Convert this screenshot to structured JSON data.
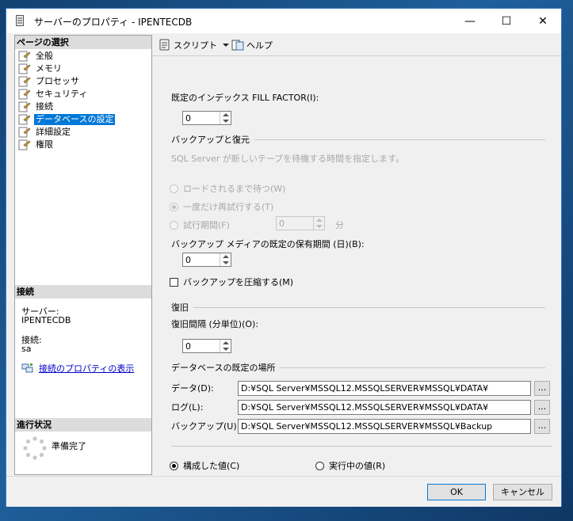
{
  "window": {
    "title": "サーバーのプロパティ - IPENTECDB",
    "minimize": "—",
    "maximize": "☐",
    "close": "✕"
  },
  "left_pane": {
    "header": "ページの選択",
    "items": [
      {
        "label": "全般",
        "selected": false
      },
      {
        "label": "メモリ",
        "selected": false
      },
      {
        "label": "プロセッサ",
        "selected": false
      },
      {
        "label": "セキュリティ",
        "selected": false
      },
      {
        "label": "接続",
        "selected": false
      },
      {
        "label": "データベースの設定",
        "selected": true
      },
      {
        "label": "詳細設定",
        "selected": false
      },
      {
        "label": "権限",
        "selected": false
      }
    ],
    "connection_header": "接続",
    "server_label": "サーバー:",
    "server_value": "IPENTECDB",
    "connection_label": "接続:",
    "connection_value": "sa",
    "connection_link": "接続のプロパティの表示",
    "progress_header": "進行状況",
    "progress_status": "準備完了"
  },
  "toolbar": {
    "script_label": "スクリプト",
    "help_label": "ヘルプ"
  },
  "content": {
    "fill_factor_label": "既定のインデックス FILL FACTOR(I):",
    "fill_factor_value": "0",
    "backup_restore_title": "バックアップと復元",
    "tape_wait_label": "SQL Server が新しいテープを待機する時間を指定します。",
    "radio_wait_loaded": "ロードされるまで待つ(W)",
    "radio_retry_once": "一度だけ再試行する(T)",
    "radio_trial_period": "試行期間(F)",
    "trial_period_value": "0",
    "trial_period_unit": "分",
    "retention_label": "バックアップ メディアの既定の保有期間 (日)(B):",
    "retention_value": "0",
    "compress_label": "バックアップを圧縮する(M)",
    "recovery_title": "復旧",
    "recovery_interval_label": "復旧間隔 (分単位)(O):",
    "recovery_interval_value": "0",
    "db_locations_title": "データベースの既定の場所",
    "data_label": "データ(D):",
    "data_path": "D:¥SQL Server¥MSSQL12.MSSQLSERVER¥MSSQL¥DATA¥",
    "log_label": "ログ(L):",
    "log_path": "D:¥SQL Server¥MSSQL12.MSSQLSERVER¥MSSQL¥DATA¥",
    "backup_label": "バックアップ(U):",
    "backup_path": "D:¥SQL Server¥MSSQL12.MSSQLSERVER¥MSSQL¥Backup",
    "browse_label": "...",
    "radio_configured": "構成した値(C)",
    "radio_running": "実行中の値(R)"
  },
  "buttons": {
    "ok": "OK",
    "cancel": "キャンセル"
  }
}
